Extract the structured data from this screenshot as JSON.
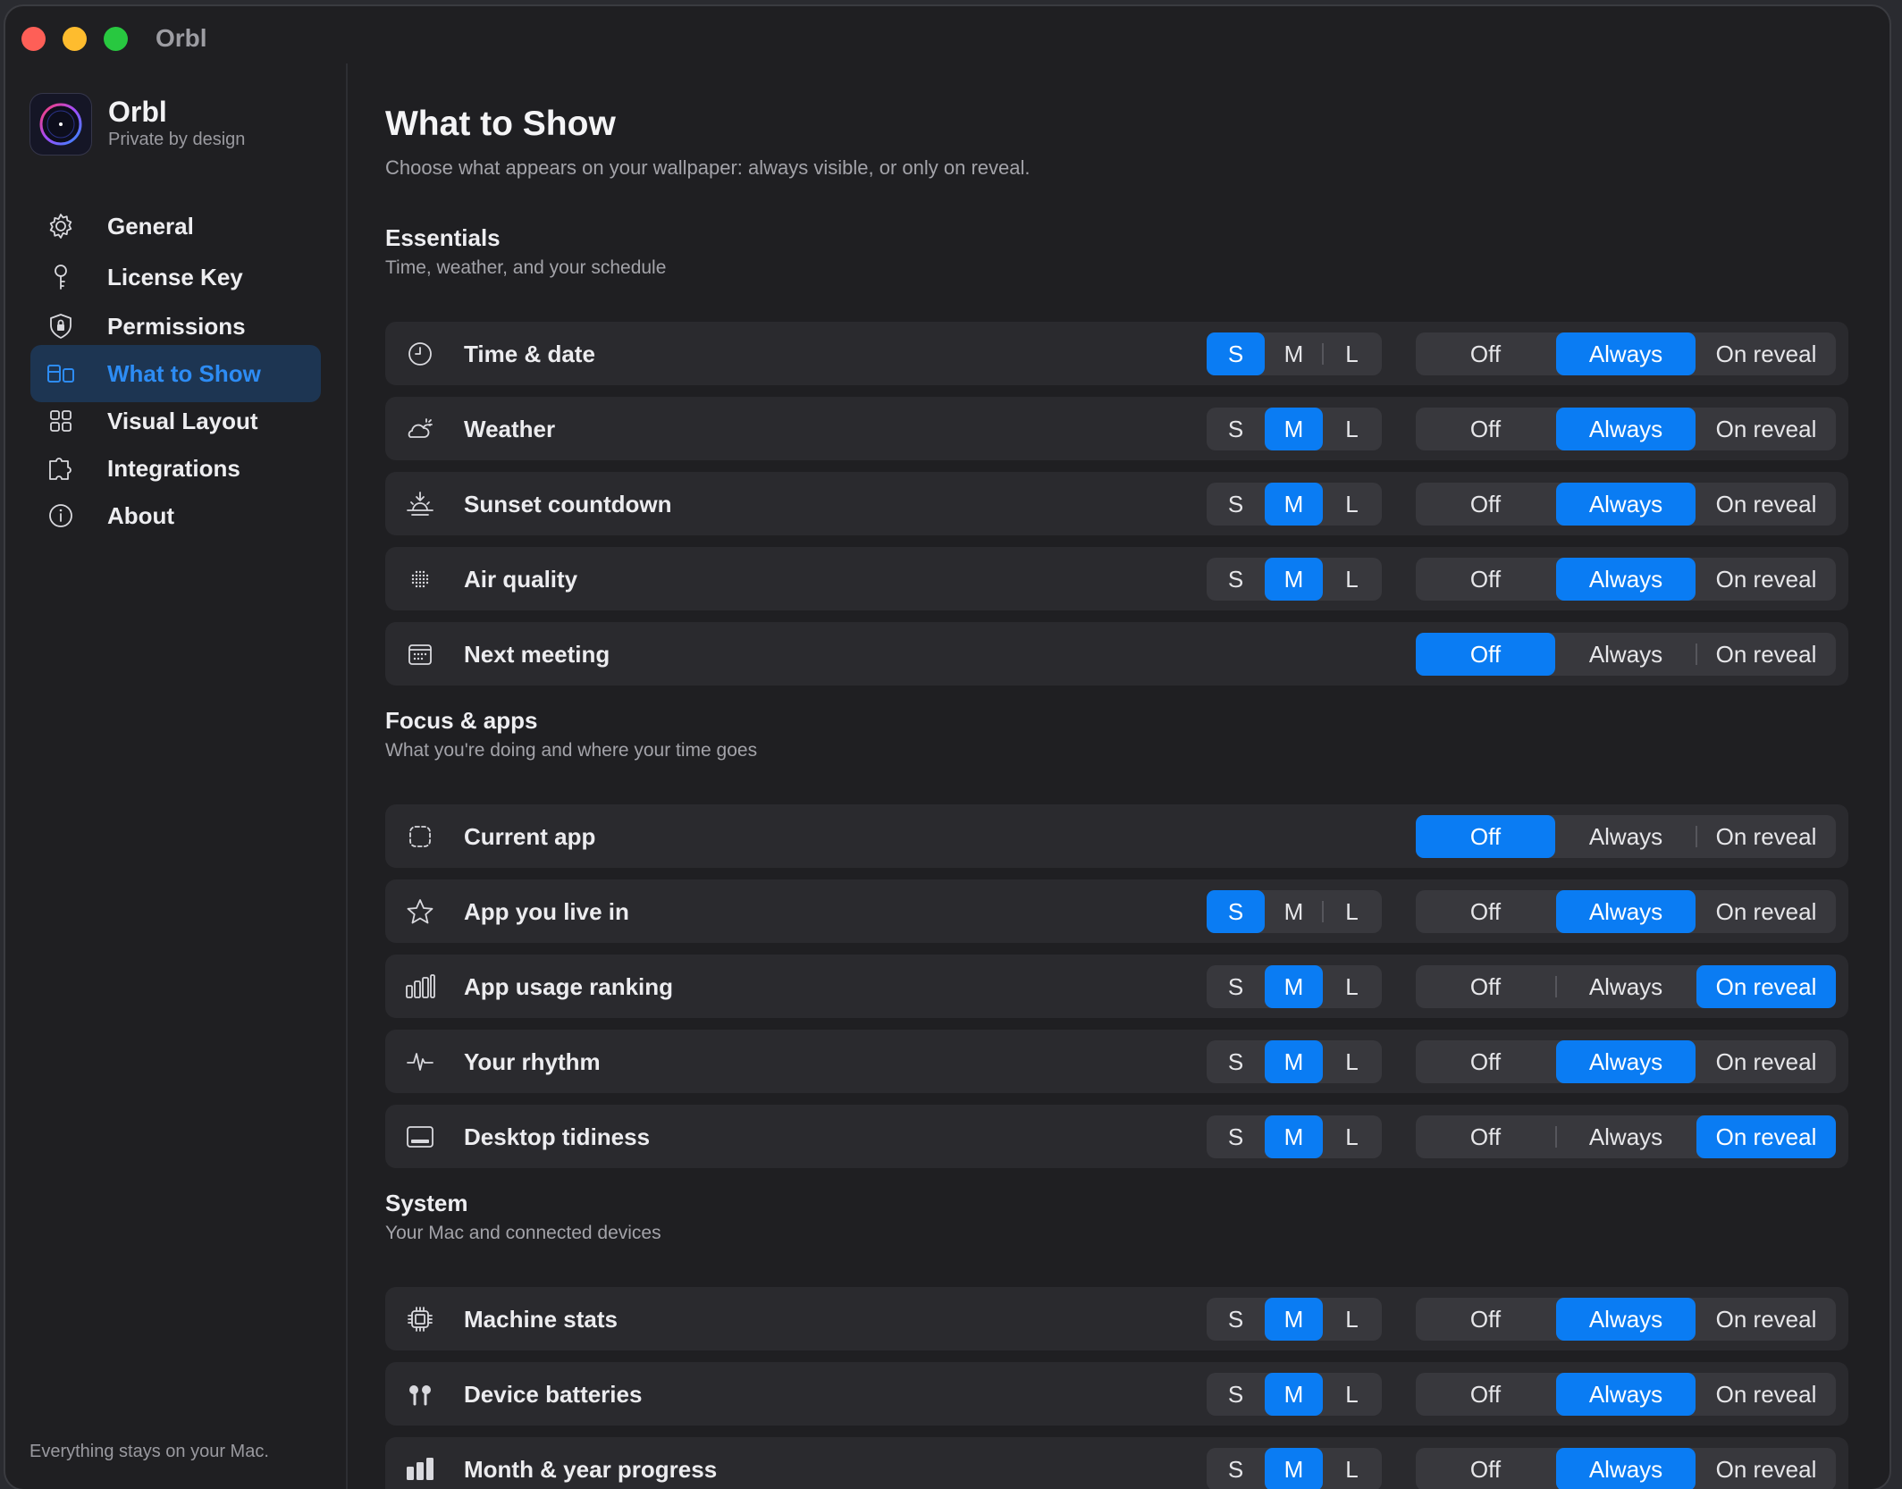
{
  "window": {
    "title": "Orbl"
  },
  "brand": {
    "name": "Orbl",
    "tagline": "Private by design"
  },
  "nav": [
    {
      "label": "General",
      "icon": "gear-icon",
      "active": false
    },
    {
      "label": "License Key",
      "icon": "key-icon",
      "active": false
    },
    {
      "label": "Permissions",
      "icon": "shield-lock-icon",
      "active": false
    },
    {
      "label": "What to Show",
      "icon": "layout-panels-icon",
      "active": true
    },
    {
      "label": "Visual Layout",
      "icon": "grid-icon",
      "active": false
    },
    {
      "label": "Integrations",
      "icon": "puzzle-icon",
      "active": false
    },
    {
      "label": "About",
      "icon": "info-icon",
      "active": false
    }
  ],
  "sidebar_footer": "Everything stays on your Mac.",
  "page": {
    "title": "What to Show",
    "subtitle": "Choose what appears on your wallpaper: always visible, or only on reveal."
  },
  "size_options": [
    "S",
    "M",
    "L"
  ],
  "visibility_options": [
    "Off",
    "Always",
    "On reveal"
  ],
  "colors": {
    "accent": "#0a7cf3",
    "background": "#1f1f22",
    "row": "#2a2a2e",
    "segment": "#38383d"
  },
  "sections": [
    {
      "title": "Essentials",
      "subtitle": "Time, weather, and your schedule",
      "items": [
        {
          "label": "Time & date",
          "icon": "clock-icon",
          "size": "S",
          "visibility": "Always"
        },
        {
          "label": "Weather",
          "icon": "cloud-sun-icon",
          "size": "M",
          "visibility": "Always"
        },
        {
          "label": "Sunset countdown",
          "icon": "sunset-icon",
          "size": "M",
          "visibility": "Always"
        },
        {
          "label": "Air quality",
          "icon": "dots-icon",
          "size": "M",
          "visibility": "Always"
        },
        {
          "label": "Next meeting",
          "icon": "calendar-icon",
          "size": null,
          "visibility": "Off"
        }
      ]
    },
    {
      "title": "Focus & apps",
      "subtitle": "What you're doing and where your time goes",
      "items": [
        {
          "label": "Current app",
          "icon": "app-frame-icon",
          "size": null,
          "visibility": "Off"
        },
        {
          "label": "App you live in",
          "icon": "star-icon",
          "size": "S",
          "visibility": "Always"
        },
        {
          "label": "App usage ranking",
          "icon": "bar-chart-icon",
          "size": "M",
          "visibility": "On reveal"
        },
        {
          "label": "Your rhythm",
          "icon": "waveform-icon",
          "size": "M",
          "visibility": "Always"
        },
        {
          "label": "Desktop tidiness",
          "icon": "desktop-icon",
          "size": "M",
          "visibility": "On reveal"
        }
      ]
    },
    {
      "title": "System",
      "subtitle": "Your Mac and connected devices",
      "items": [
        {
          "label": "Machine stats",
          "icon": "cpu-icon",
          "size": "M",
          "visibility": "Always"
        },
        {
          "label": "Device batteries",
          "icon": "airpods-icon",
          "size": "M",
          "visibility": "Always"
        },
        {
          "label": "Month & year progress",
          "icon": "progress-bars-icon",
          "size": "M",
          "visibility": "Always"
        }
      ]
    }
  ]
}
